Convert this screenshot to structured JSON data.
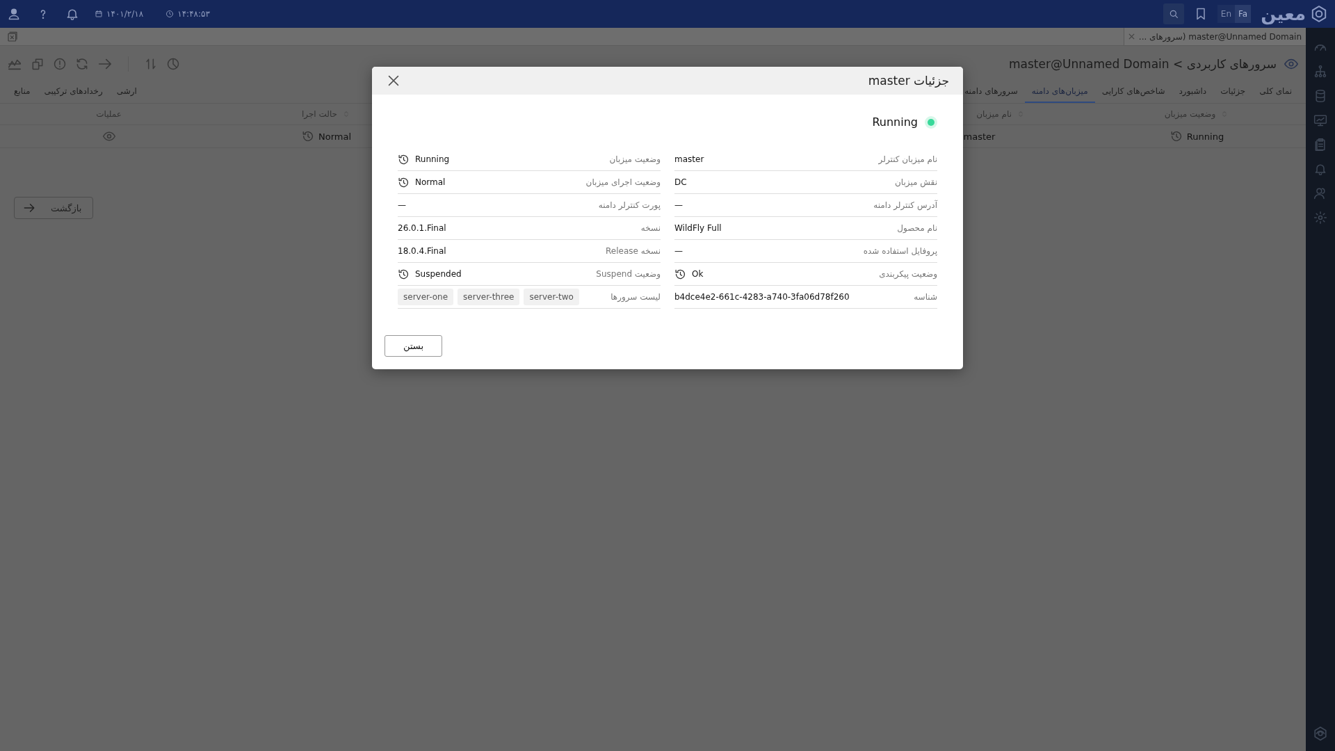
{
  "top_bar": {
    "date": "۱۴۰۱/۲/۱۸",
    "time": "۱۴:۴۸:۵۳",
    "logo": "معین",
    "languages": [
      {
        "label": "Fa",
        "selected": true
      },
      {
        "label": "En",
        "selected": false
      }
    ]
  },
  "open_tabs": [
    {
      "label": "master@Unnamed Domain (سرورهای ...",
      "selected": true
    }
  ],
  "page": {
    "title": "سرورهای کاربردی > master@Unnamed Domain",
    "tabs_right": [
      {
        "label": "نمای کلی",
        "selected": false
      },
      {
        "label": "جزئیات",
        "selected": false
      },
      {
        "label": "داشبورد",
        "selected": false
      },
      {
        "label": "شاخص‌های کارایی",
        "selected": false
      },
      {
        "label": "میزبان‌های دامنه",
        "selected": true
      },
      {
        "label": "سرورهای دامنه",
        "selected": false
      }
    ],
    "tabs_left": [
      {
        "label": "ارشی",
        "selected": false
      },
      {
        "label": "رخدادهای ترکیبی",
        "selected": false
      },
      {
        "label": "منابع",
        "selected": false
      }
    ],
    "table": {
      "columns": [
        {
          "label": "وضعیت میزبان",
          "sortable": true
        },
        {
          "label": "نام میزبان",
          "sortable": true
        },
        {
          "label": "حالت اجرا",
          "sortable": true
        },
        {
          "label": "عملیات",
          "sortable": false
        }
      ],
      "rows": [
        {
          "cells": [
            {
              "kind": "history",
              "text": "Running"
            },
            {
              "kind": "text",
              "text": "master"
            },
            {
              "kind": "history",
              "text": "Normal"
            },
            {
              "kind": "view"
            }
          ]
        }
      ]
    },
    "back_button": "بازگشت"
  },
  "dialog": {
    "title": "جزئیات master",
    "status": "Running",
    "right_column": [
      {
        "kind": "text",
        "label": "نام میزبان کنترلر",
        "value": "master"
      },
      {
        "kind": "text",
        "label": "نقش میزبان",
        "value": "DC"
      },
      {
        "kind": "text",
        "label": "آدرس کنترلر دامنه",
        "value": "—"
      },
      {
        "kind": "text",
        "label": "نام محصول",
        "value": "WildFly Full"
      },
      {
        "kind": "text",
        "label": "پروفایل استفاده شده",
        "value": "—"
      },
      {
        "kind": "history",
        "label": "وضعیت پیکربندی",
        "value": "Ok"
      },
      {
        "kind": "text",
        "label": "شناسه",
        "value": "b4dce4e2-661c-4283-a740-3fa06d78f260"
      }
    ],
    "left_column": [
      {
        "kind": "history",
        "label": "وضعیت میزبان",
        "value": "Running"
      },
      {
        "kind": "history",
        "label": "وضعیت اجرای میزبان",
        "value": "Normal"
      },
      {
        "kind": "text",
        "label": "پورت کنترلر دامنه",
        "value": "—"
      },
      {
        "kind": "text",
        "label": "نسخه",
        "value": "26.0.1.Final"
      },
      {
        "kind": "text",
        "label": "نسخه Release",
        "value": "18.0.4.Final"
      },
      {
        "kind": "history",
        "label": "وضعیت Suspend",
        "value": "Suspended"
      },
      {
        "kind": "chips",
        "label": "لیست سرورها",
        "chips": [
          "server-two",
          "server-three",
          "server-one"
        ]
      }
    ],
    "close_button": "بستن"
  }
}
